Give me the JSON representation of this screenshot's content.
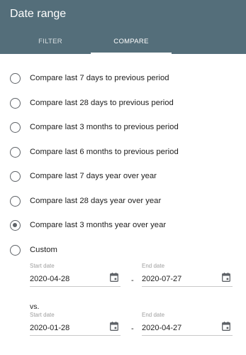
{
  "header": {
    "title": "Date range",
    "tabs": [
      {
        "label": "FILTER"
      },
      {
        "label": "COMPARE"
      }
    ],
    "active_tab": "COMPARE"
  },
  "options": [
    {
      "label": "Compare last 7 days to previous period",
      "checked": false
    },
    {
      "label": "Compare last 28 days to previous period",
      "checked": false
    },
    {
      "label": "Compare last 3 months to previous period",
      "checked": false
    },
    {
      "label": "Compare last 6 months to previous period",
      "checked": false
    },
    {
      "label": "Compare last 7 days year over year",
      "checked": false
    },
    {
      "label": "Compare last 28 days year over year",
      "checked": false
    },
    {
      "label": "Compare last 3 months year over year",
      "checked": true
    },
    {
      "label": "Custom",
      "checked": false
    }
  ],
  "custom": {
    "range1": {
      "start_label": "Start date",
      "start_value": "2020-04-28",
      "separator": "-",
      "end_label": "End date",
      "end_value": "2020-07-27"
    },
    "vs_label": "vs.",
    "range2": {
      "start_label": "Start date",
      "start_value": "2020-01-28",
      "separator": "-",
      "end_label": "End date",
      "end_value": "2020-04-27"
    }
  },
  "colors": {
    "header_bg": "#546e7a",
    "radio": "#5f6368"
  },
  "icons": {
    "date_field": "calendar-icon"
  }
}
